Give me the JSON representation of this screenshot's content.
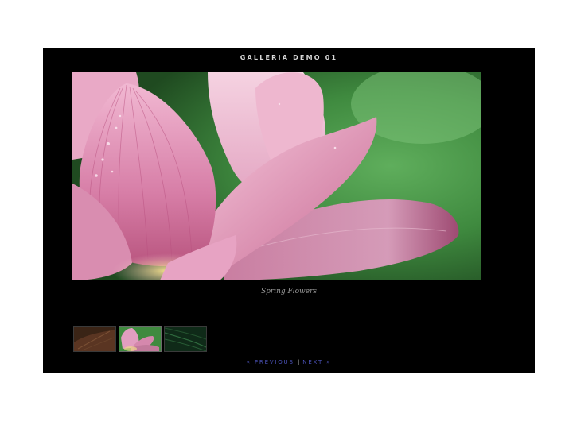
{
  "gallery": {
    "title": "GALLERIA DEMO 01",
    "caption": "Spring Flowers",
    "thumbnails": [
      {
        "name": "brown-leaf-thumbnail"
      },
      {
        "name": "lotus-flower-thumbnail",
        "active": true
      },
      {
        "name": "green-leaf-thumbnail"
      }
    ],
    "nav": {
      "previous_label": "« PREVIOUS",
      "separator": "|",
      "next_label": "NEXT »"
    }
  },
  "colors": {
    "panel_background": "#000000",
    "page_background": "#ffffff",
    "link_color": "#4b52b8",
    "title_color": "#d8d8d8",
    "caption_color": "#9a9a9a"
  }
}
